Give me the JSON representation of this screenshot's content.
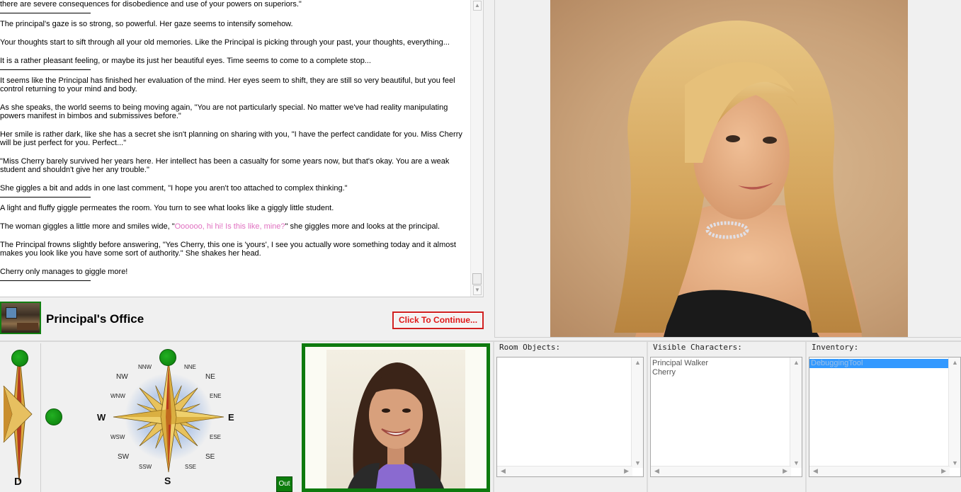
{
  "story": {
    "paragraphs": [
      {
        "text": "there are severe consequences for disobedience and use of your powers on superiors.\"",
        "sep": true
      },
      {
        "text": "The principal's gaze is so strong, so powerful.  Her gaze seems to intensify somehow."
      },
      {
        "text": "Your thoughts start to sift through all your old memories.  Like the Principal is picking through your past, your thoughts, everything..."
      },
      {
        "text": "It is a rather pleasant feeling, or maybe its just her beautiful eyes.  Time seems to come to a complete stop...",
        "sep": true
      },
      {
        "text": "It seems like the Principal has finished her evaluation of the mind.  Her eyes seem to shift, they are still so very beautiful, but you feel control returning to your mind and body."
      },
      {
        "text": "As she speaks, the world seems to being moving again, \"You are not particularly special.  No matter we've had reality manipulating powers manifest in bimbos and submissives before.\""
      },
      {
        "text": "Her smile is rather dark, like she has a secret she isn't planning on sharing with you, \"I have the perfect candidate for you.  Miss Cherry will be just perfect for you.  Perfect...\""
      },
      {
        "text": "\"Miss Cherry barely survived her years here.  Her intellect has been a casualty for some years now, but that's okay.  You are a weak student and shouldn't give her any trouble.\""
      },
      {
        "text": "She giggles a bit and adds in one last comment, \"I hope you aren't too attached to complex thinking.\"",
        "sep": true
      },
      {
        "text": "A light and fluffy giggle permeates the room.  You turn to see what looks like a giggly little student."
      },
      {
        "pre": "The woman giggles a little more and smiles wide, \"",
        "highlight": "Oooooo, hi hi!  Is this like, mine?",
        "post": "\"  she giggles more and looks at the principal."
      },
      {
        "text": "The Principal frowns slightly before answering, \"Yes Cherry, this one is 'yours', I see you actually wore something today and it almost makes you look like you have some sort of authority.\"  She shakes her head."
      },
      {
        "text": "Cherry only manages to giggle more!",
        "sep": true
      }
    ],
    "highlight_color": "#e070c0"
  },
  "location": {
    "name": "Principal's Office",
    "continue_label": "Click To Continue..."
  },
  "compass": {
    "vertical_label": "D",
    "labels": {
      "N": "",
      "S": "S",
      "E": "E",
      "W": "W",
      "NE": "NE",
      "NW": "NW",
      "SE": "SE",
      "SW": "SW",
      "NNE": "NNE",
      "NNW": "NNW",
      "ENE": "ENE",
      "ESE": "ESE",
      "SSE": "SSE",
      "SSW": "SSW",
      "WSW": "WSW",
      "WNW": "WNW"
    },
    "out_label": "Out"
  },
  "panels": {
    "room_objects": {
      "title": "Room Objects:",
      "items": []
    },
    "visible_characters": {
      "title": "Visible Characters:",
      "items": [
        "Principal Walker",
        "Cherry"
      ]
    },
    "inventory": {
      "title": "Inventory:",
      "items": [
        "DebuggingTool"
      ]
    }
  },
  "colors": {
    "frame_green": "#127f12",
    "continue_red": "#e01818",
    "selection_blue": "#3399ff"
  }
}
